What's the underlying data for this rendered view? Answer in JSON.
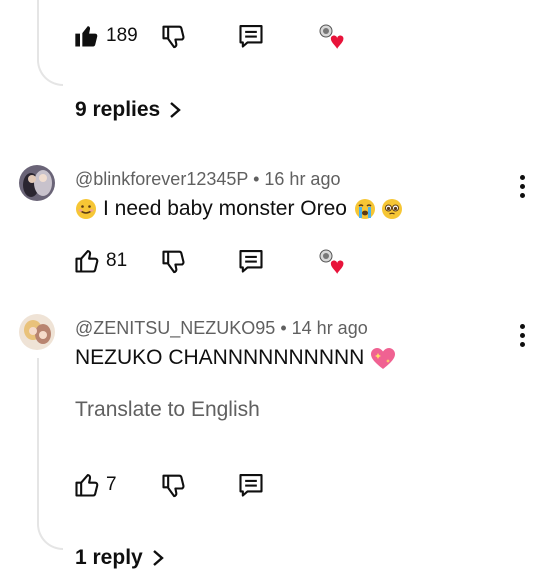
{
  "thread1": {
    "likes": "189",
    "replies_label": "9 replies"
  },
  "comment2": {
    "handle": "@blinkforever12345P",
    "separator": "•",
    "time": "16 hr ago",
    "text": "I need baby monster Oreo",
    "likes": "81"
  },
  "comment3": {
    "handle": "@ZENITSU_NEZUKO95",
    "separator": "•",
    "time": "14 hr ago",
    "text": "NEZUKO CHANNNNNNNNNN",
    "translate": "Translate to English",
    "likes": "7",
    "replies_label": "1 reply"
  },
  "icons": {
    "like": "thumbs-up-icon",
    "dislike": "thumbs-down-icon",
    "reply": "comment-reply-icon",
    "creator_heart": "creator-heart-icon",
    "more": "more-vertical-icon",
    "chevron": "chevron-right-icon"
  },
  "colors": {
    "text": "#0f0f0f",
    "secondary": "#606060",
    "heart": "#e8133a",
    "thread_line": "#e5e5e5"
  }
}
